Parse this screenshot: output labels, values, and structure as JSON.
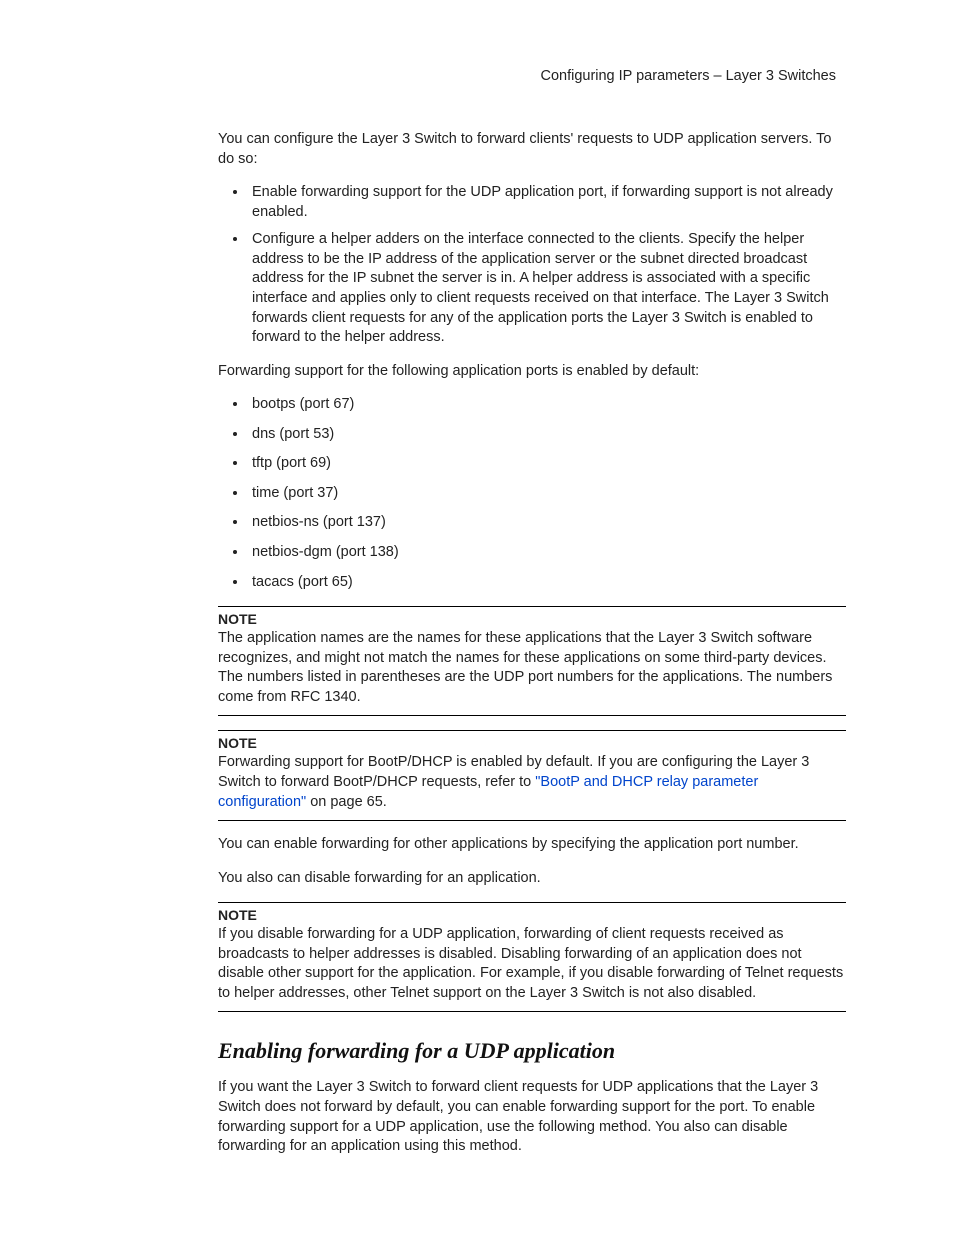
{
  "header": "Configuring IP parameters – Layer 3 Switches",
  "intro": "You can configure the Layer 3 Switch to forward clients' requests to UDP application servers.  To do so:",
  "steps": [
    "Enable forwarding support for the UDP application port, if forwarding support is not already enabled.",
    "Configure a helper adders on the interface connected to the clients.  Specify the helper address to be the IP address of the application server or the subnet directed broadcast address for the IP subnet the server is in.  A helper address is associated with a specific interface and applies only to client requests received on that interface.  The Layer 3 Switch forwards client requests for any of the application ports the Layer 3 Switch is enabled to forward to the helper address."
  ],
  "ports_intro": "Forwarding support for the following application ports is enabled by default:",
  "ports": [
    "bootps (port 67)",
    "dns (port 53)",
    "tftp (port 69)",
    "time (port 37)",
    "netbios-ns (port 137)",
    "netbios-dgm (port 138)",
    "tacacs (port 65)"
  ],
  "note_label": "NOTE",
  "note1": "The application names are the names for these applications that the Layer 3 Switch software recognizes, and might not match the names for these applications on some third-party devices.  The numbers listed in parentheses are the UDP port numbers for the applications.  The numbers come from RFC 1340.",
  "note2_part1": "Forwarding support for BootP/DHCP is enabled by default.  If you are configuring the Layer 3 Switch to forward BootP/DHCP requests, refer to ",
  "note2_link": "\"BootP and DHCP relay parameter configuration\"",
  "note2_part2": " on page 65.",
  "para1": "You can enable forwarding for other applications by specifying the application port number.",
  "para2": "You also can disable forwarding for an application.",
  "note3": "If you disable forwarding for a UDP application, forwarding of client requests received as broadcasts to helper addresses is disabled.  Disabling forwarding of an application does not disable other support for the application.  For example, if you disable forwarding of Telnet requests to helper addresses, other Telnet support on the Layer 3 Switch is not also disabled.",
  "h2": "Enabling forwarding for a UDP application",
  "section_para": "If you want the Layer 3 Switch to forward client requests for UDP applications that the Layer 3 Switch does not forward by default, you can enable forwarding support for the port.  To enable forwarding support for a UDP application, use the following method.  You also can disable forwarding for an application using this method."
}
